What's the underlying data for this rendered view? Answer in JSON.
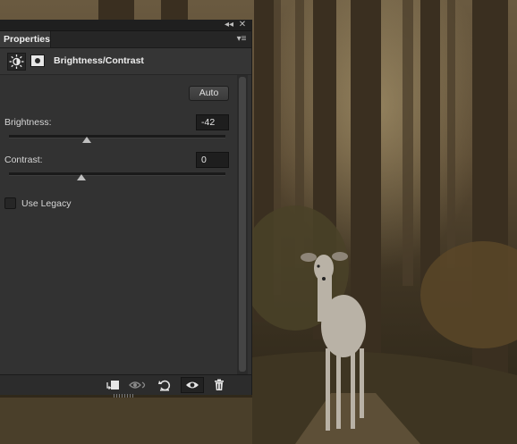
{
  "panel": {
    "titlebar": {
      "collapse_glyph": "◂◂",
      "close_glyph": "✕"
    },
    "tab_label": "Properties",
    "menu_glyph": "▾≡",
    "adjustment": {
      "icon": "brightness-sun-icon",
      "mask_icon": "layer-mask-icon",
      "title": "Brightness/Contrast"
    },
    "auto_label": "Auto",
    "brightness": {
      "label": "Brightness:",
      "value": "-42",
      "min": -150,
      "max": 150,
      "numeric": -42
    },
    "contrast": {
      "label": "Contrast:",
      "value": "0",
      "min": -50,
      "max": 100,
      "numeric": 0
    },
    "use_legacy_label": "Use Legacy",
    "use_legacy_checked": false,
    "bottom_buttons": [
      {
        "name": "clip-to-layer-icon",
        "selected": false
      },
      {
        "name": "view-previous-state-icon",
        "selected": false
      },
      {
        "name": "reset-adjustment-icon",
        "selected": false
      },
      {
        "name": "toggle-visibility-eye-icon",
        "selected": true
      },
      {
        "name": "delete-adjustment-trash-icon",
        "selected": false
      }
    ]
  },
  "colors": {
    "panel_bg": "#323232",
    "field_bg": "#1e1e1e",
    "text": "#d8d8d8"
  }
}
